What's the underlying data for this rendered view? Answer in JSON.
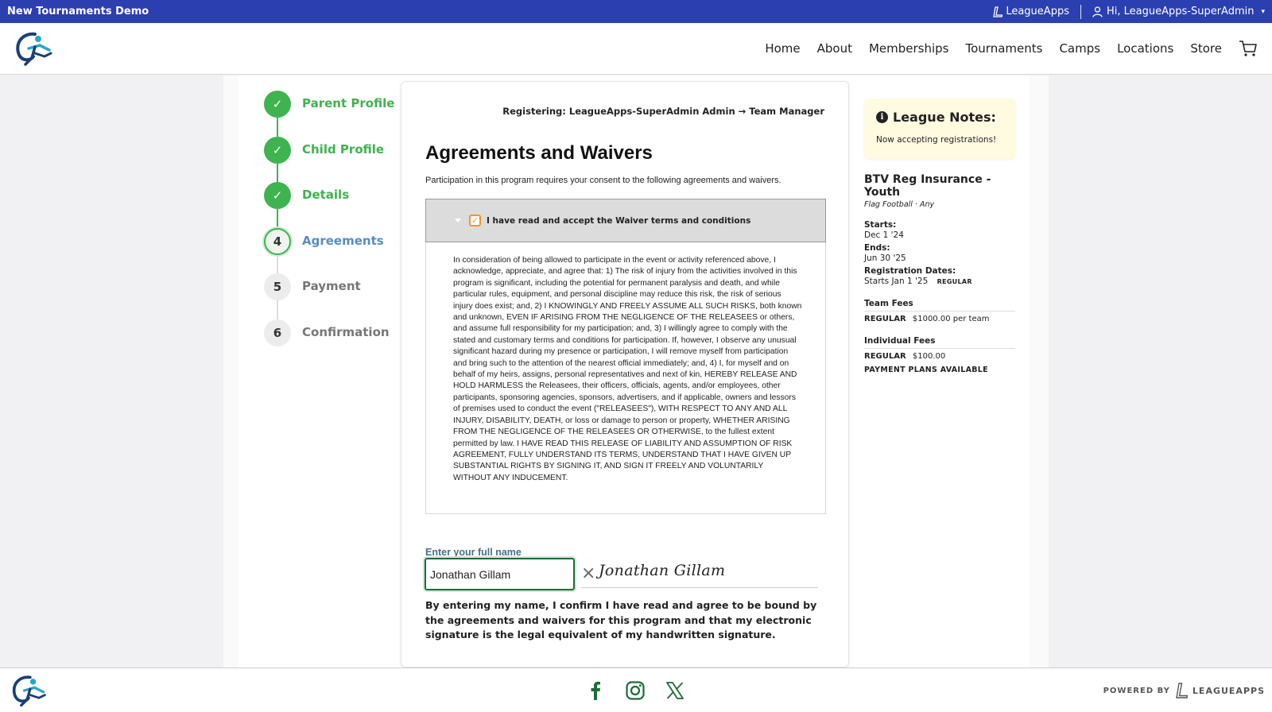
{
  "topbar": {
    "title": "New Tournaments Demo",
    "brand": "LeagueApps",
    "user": "Hi, LeagueApps-SuperAdmin"
  },
  "nav": {
    "items": [
      "Home",
      "About",
      "Memberships",
      "Tournaments",
      "Camps",
      "Locations",
      "Store"
    ]
  },
  "stepper": {
    "steps": [
      {
        "number": "✓",
        "label": "Parent Profile",
        "state": "done"
      },
      {
        "number": "✓",
        "label": "Child Profile",
        "state": "done"
      },
      {
        "number": "✓",
        "label": "Details",
        "state": "done"
      },
      {
        "number": "4",
        "label": "Agreements",
        "state": "active"
      },
      {
        "number": "5",
        "label": "Payment",
        "state": "todo"
      },
      {
        "number": "6",
        "label": "Confirmation",
        "state": "todo"
      }
    ]
  },
  "main": {
    "registering": "Registering: LeagueApps-SuperAdmin Admin → Team Manager",
    "title": "Agreements and Waivers",
    "intro": "Participation in this program requires your consent to the following agreements and waivers.",
    "waiver": {
      "accept_label": "I have read and accept the Waiver terms and conditions",
      "checked": true,
      "body": "In consideration of being allowed to participate in the event or activity referenced above, I acknowledge, appreciate, and agree that: 1) The risk of injury from the activities involved in this program is significant, including the potential for permanent paralysis and death, and while particular rules, equipment, and personal discipline may reduce this risk, the risk of serious injury does exist; and, 2) I KNOWINGLY AND FREELY ASSUME ALL SUCH RISKS, both known and unknown, EVEN IF ARISING FROM THE NEGLIGENCE OF THE RELEASEES or others, and assume full responsibility for my participation; and, 3) I willingly agree to comply with the stated and customary terms and conditions for participation. If, however, I observe any unusual significant hazard during my presence or participation, I will remove myself from participation and bring such to the attention of the nearest official immediately; and, 4) I, for myself and on behalf of my heirs, assigns, personal representatives and next of kin, HEREBY RELEASE AND HOLD HARMLESS the Releasees, their officers, officials, agents, and/or employees, other participants, sponsoring agencies, sponsors, advertisers, and if applicable, owners and lessors of premises used to conduct the event (\"RELEASEES\"), WITH RESPECT TO ANY AND ALL INJURY, DISABILITY, DEATH, or loss or damage to person or property, WHETHER ARISING FROM THE NEGLIGENCE OF THE RELEASEES OR OTHERWISE, to the fullest extent permitted by law. I HAVE READ THIS RELEASE OF LIABILITY AND ASSUMPTION OF RISK AGREEMENT, FULLY UNDERSTAND ITS TERMS, UNDERSTAND THAT I HAVE GIVEN UP SUBSTANTIAL RIGHTS BY SIGNING IT, AND SIGN IT FREELY AND VOLUNTARILY WITHOUT ANY INDUCEMENT."
    },
    "name_label": "Enter your full name",
    "name_value": "Jonathan Gillam",
    "signature": "Jonathan Gillam",
    "confirm_text": "By entering my name, I confirm I have read and agree to be bound by the agreements and waivers for this program and that my electronic signature is the legal equivalent of my handwritten signature."
  },
  "sidebar": {
    "notes_title": "League Notes:",
    "notes_body": "Now accepting registrations!",
    "program_title": "BTV Reg Insurance - Youth",
    "program_sub": "Flag Football · Any",
    "starts_label": "Starts:",
    "starts_value": "Dec 1 '24",
    "ends_label": "Ends:",
    "ends_value": "Jun 30 '25",
    "reg_label": "Registration Dates:",
    "reg_value": "Starts Jan 1 '25",
    "reg_badge": "REGULAR",
    "team_fees_label": "Team Fees",
    "team_fee_type": "REGULAR",
    "team_fee_value": "$1000.00 per team",
    "ind_fees_label": "Individual Fees",
    "ind_fee_type": "REGULAR",
    "ind_fee_value": "$100.00",
    "payment_plans": "PAYMENT PLANS AVAILABLE"
  },
  "footer": {
    "powered_by": "POWERED BY",
    "brand": "LEAGUEAPPS"
  },
  "colors": {
    "topbar": "#2b3fb0",
    "success": "#3fb34f",
    "active_step": "#5a8bc0",
    "checkbox": "#f0962c",
    "notes_bg": "#fffbe1"
  }
}
